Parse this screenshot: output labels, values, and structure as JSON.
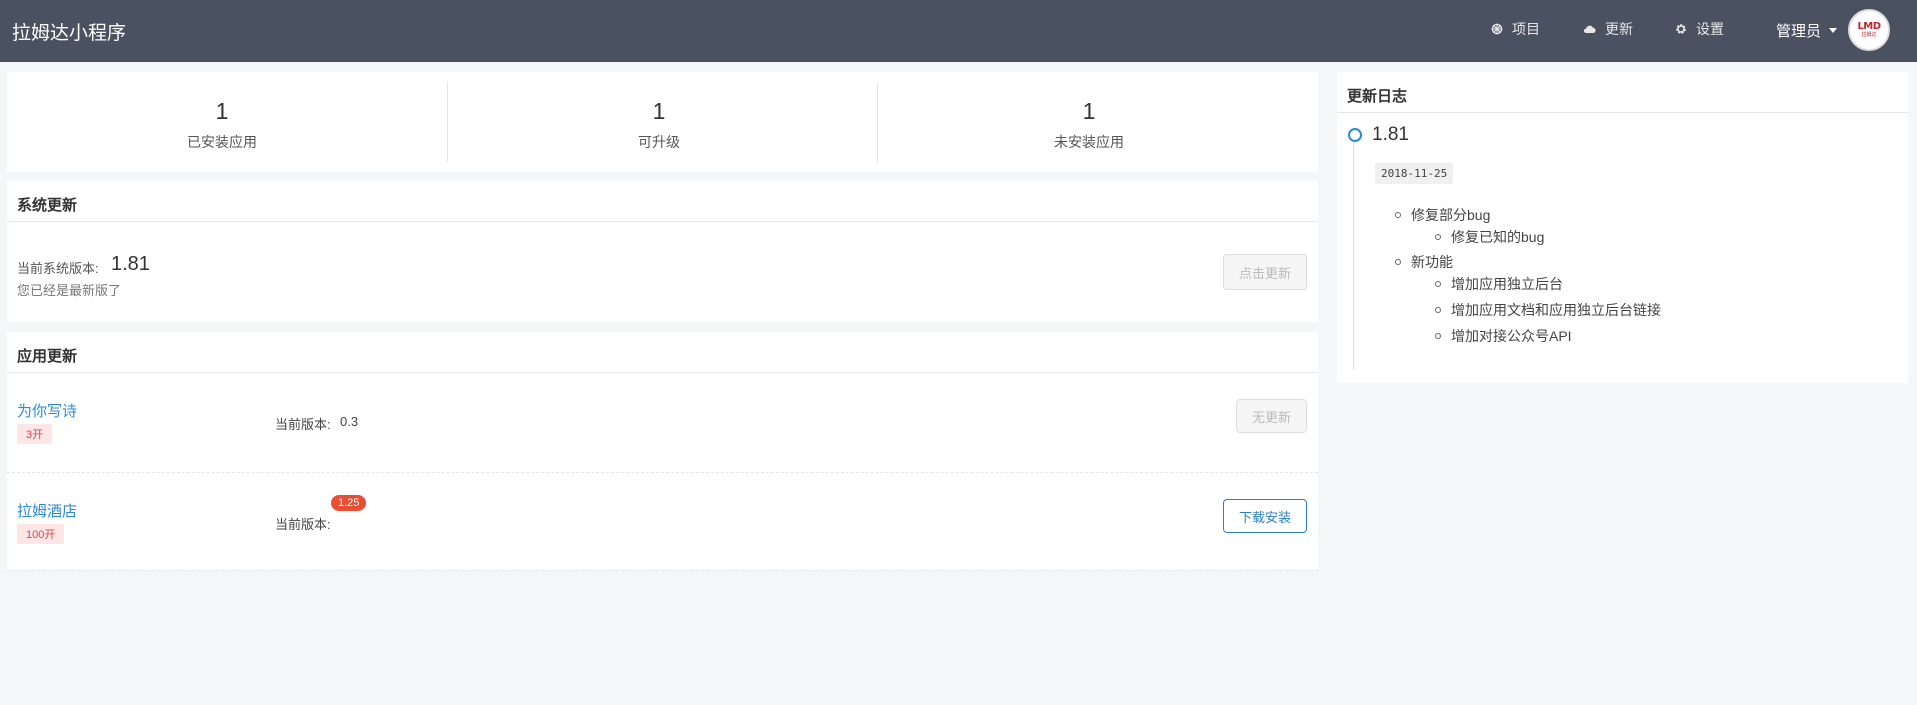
{
  "header": {
    "title": "拉姆达小程序",
    "nav": [
      {
        "label": "项目",
        "icon": "ship-wheel-icon"
      },
      {
        "label": "更新",
        "icon": "cloud-icon"
      },
      {
        "label": "设置",
        "icon": "gear-icon"
      }
    ],
    "user": {
      "label": "管理员",
      "avatar_logo": "LMD",
      "avatar_sub": "拉姆达"
    }
  },
  "stats": [
    {
      "value": "1",
      "label": "已安装应用"
    },
    {
      "value": "1",
      "label": "可升级"
    },
    {
      "value": "1",
      "label": "未安装应用"
    }
  ],
  "system_update": {
    "title": "系统更新",
    "version_label": "当前系统版本:",
    "version": "1.81",
    "note": "您已经是最新版了",
    "button": "点击更新"
  },
  "app_update": {
    "title": "应用更新",
    "version_label": "当前版本:",
    "apps": [
      {
        "name": "为你写诗",
        "tag": "3开",
        "version": "0.3",
        "badge": "",
        "button": "无更新",
        "button_enabled": false
      },
      {
        "name": "拉姆酒店",
        "tag": "100开",
        "version": "",
        "badge": "1.25",
        "button": "下载安装",
        "button_enabled": true
      }
    ]
  },
  "changelog": {
    "title": "更新日志",
    "version": "1.81",
    "date": "2018-11-25",
    "groups": [
      {
        "label": "修复部分bug",
        "items": [
          "修复已知的bug"
        ]
      },
      {
        "label": "新功能",
        "items": [
          "增加应用独立后台",
          "增加应用文档和应用独立后台链接",
          "增加对接公众号API"
        ]
      }
    ]
  },
  "colors": {
    "header_bg": "#4a5160",
    "link": "#2b8ad8",
    "primary": "#2b7fc4",
    "badge": "#e94e34",
    "tag_text": "#e04343",
    "tag_bg": "#fde6e6"
  }
}
